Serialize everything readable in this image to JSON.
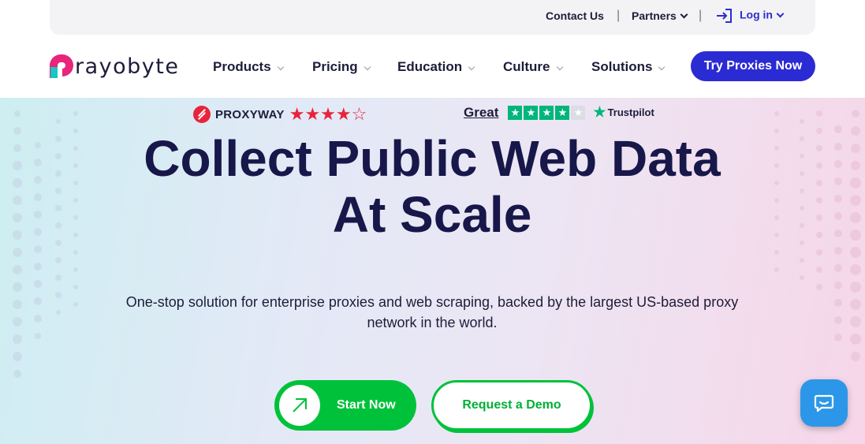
{
  "utility": {
    "contact": "Contact Us",
    "separator": "|",
    "partners": "Partners",
    "login": "Log in"
  },
  "brand": {
    "name": "rayobyte",
    "colors": {
      "pink": "#e8247c",
      "teal": "#16c7c3"
    }
  },
  "nav": {
    "items": [
      {
        "label": "Products"
      },
      {
        "label": "Pricing"
      },
      {
        "label": "Education"
      },
      {
        "label": "Culture"
      },
      {
        "label": "Solutions"
      }
    ],
    "cta": "Try Proxies Now"
  },
  "ratings": {
    "proxyway": {
      "label": "PROXYWAY",
      "stars": "★★★★☆",
      "rating": 4,
      "out_of": 5
    },
    "trustpilot": {
      "word": "Great",
      "label": "Trustpilot",
      "rating": 4,
      "out_of": 5
    }
  },
  "hero": {
    "title_line1": "Collect Public Web Data",
    "title_line2": "At Scale",
    "subtitle": "One-stop solution for enterprise proxies and web scraping, backed by the largest US-based proxy network in the world.",
    "start_button": "Start Now",
    "demo_button": "Request a Demo"
  },
  "colors": {
    "primary": "#2b2bd4",
    "green": "#00c23a",
    "heading": "#17174a",
    "chat": "#2c97e8"
  },
  "icons": [
    "login-icon",
    "arrow-up-right-icon",
    "chat-icon"
  ]
}
